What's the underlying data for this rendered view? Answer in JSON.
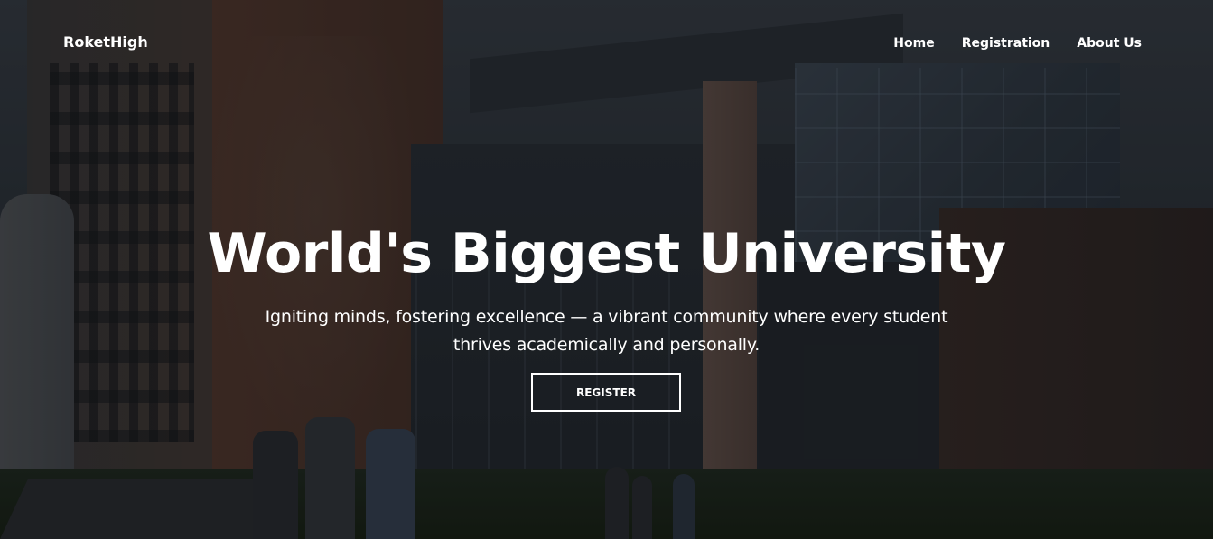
{
  "header": {
    "brand": "RoketHigh",
    "nav": [
      {
        "label": "Home"
      },
      {
        "label": "Registration"
      },
      {
        "label": "About Us"
      }
    ]
  },
  "hero": {
    "title": "World's Biggest University",
    "subtitle": "Igniting minds, fostering excellence — a vibrant community where every student thrives academically and personally.",
    "cta_label": "REGISTER",
    "background_image": "campus-buildings-photo"
  },
  "colors": {
    "text": "#ffffff",
    "overlay": "#0c0e12"
  }
}
